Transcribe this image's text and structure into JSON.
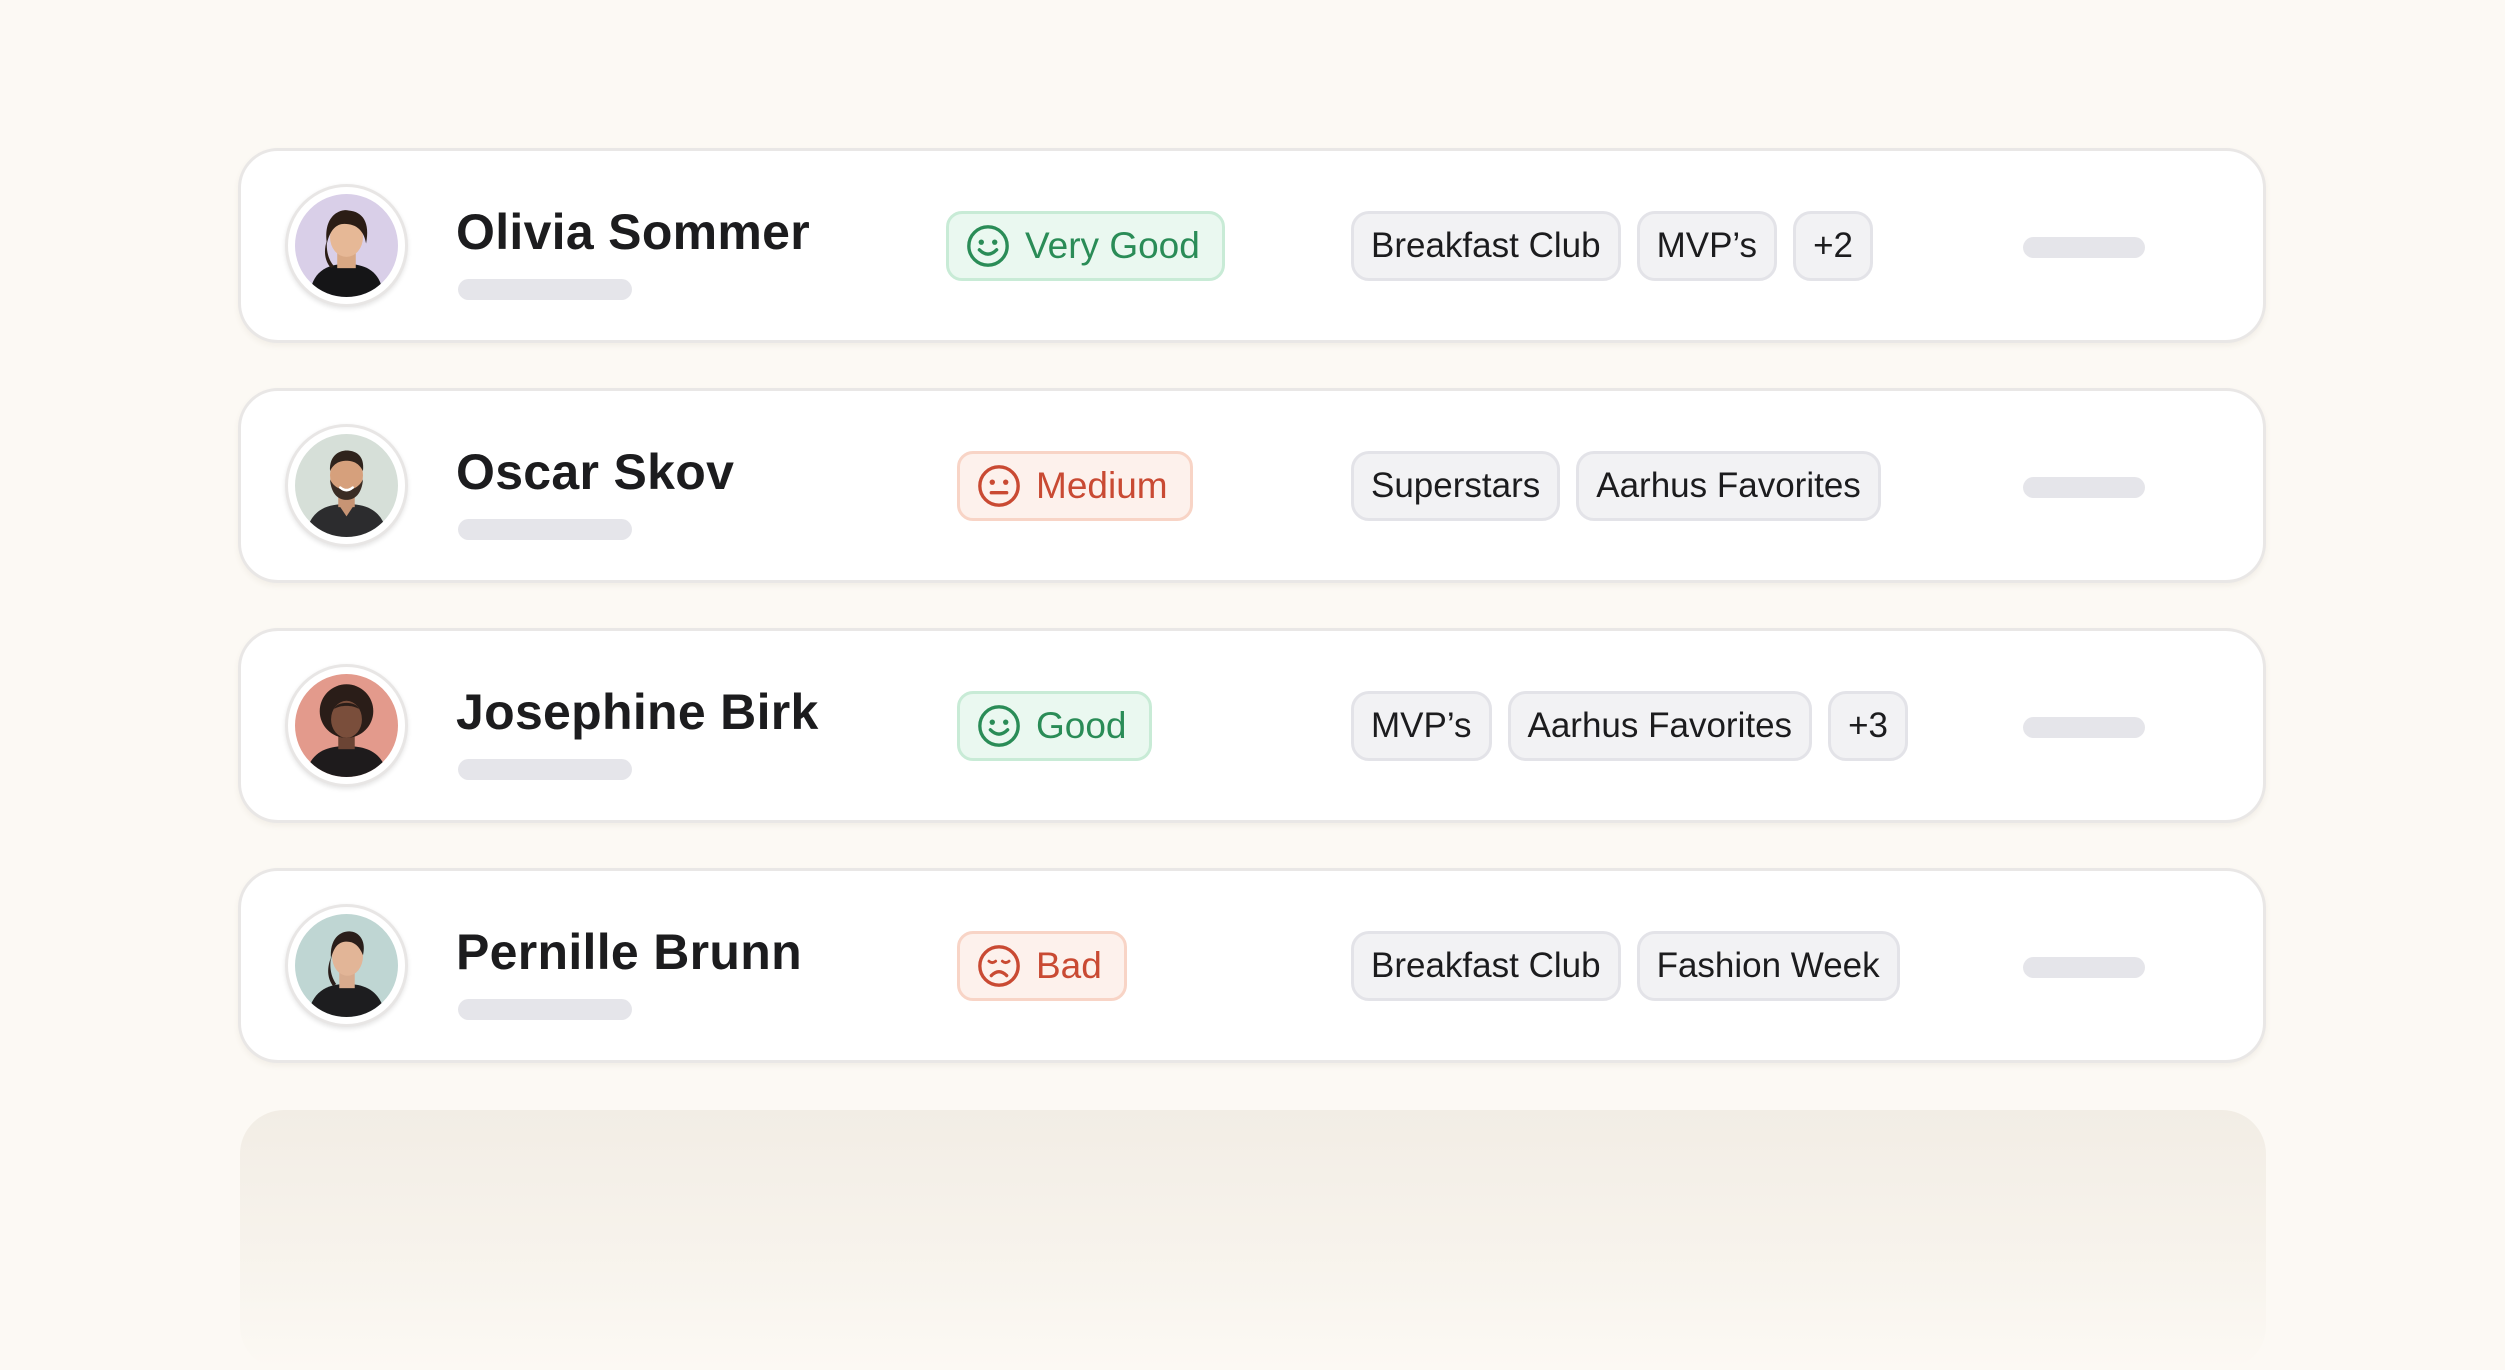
{
  "people": [
    {
      "name": "Olivia Sommer",
      "avatar": "avatar-photo-woman-bangs-black-turtleneck",
      "avatar_bg": "#d9cfe8",
      "sentiment": {
        "label": "Very Good",
        "tone": "good",
        "icon": "smile-face-icon"
      },
      "tags": [
        "Breakfast Club",
        "MVP’s",
        "+2"
      ]
    },
    {
      "name": "Oscar Skov",
      "avatar": "avatar-photo-man-beard-smiling",
      "avatar_bg": "#d6dfd8",
      "sentiment": {
        "label": "Medium",
        "tone": "bad",
        "icon": "neutral-face-icon"
      },
      "tags": [
        "Superstars",
        "Aarhus Favorites"
      ]
    },
    {
      "name": "Josephine Birk",
      "avatar": "avatar-photo-woman-curly-hair",
      "avatar_bg": "#e39a8c",
      "sentiment": {
        "label": "Good",
        "tone": "good",
        "icon": "smile-face-icon"
      },
      "tags": [
        "MVP’s",
        "Aarhus Favorites",
        "+3"
      ]
    },
    {
      "name": "Pernille Brunn",
      "avatar": "avatar-photo-woman-slicked-hair",
      "avatar_bg": "#bfd6d3",
      "sentiment": {
        "label": "Bad",
        "tone": "bad",
        "icon": "sad-face-icon"
      },
      "tags": [
        "Breakfast Club",
        "Fashion Week"
      ]
    }
  ],
  "colors": {
    "page_background": "#fcf9f4",
    "good_text": "#2a8c57",
    "good_background": "#eaf8f0",
    "bad_text": "#c94a33",
    "bad_background": "#fdf1ec",
    "tag_background": "#f2f2f4",
    "skeleton": "#e5e5ea"
  }
}
